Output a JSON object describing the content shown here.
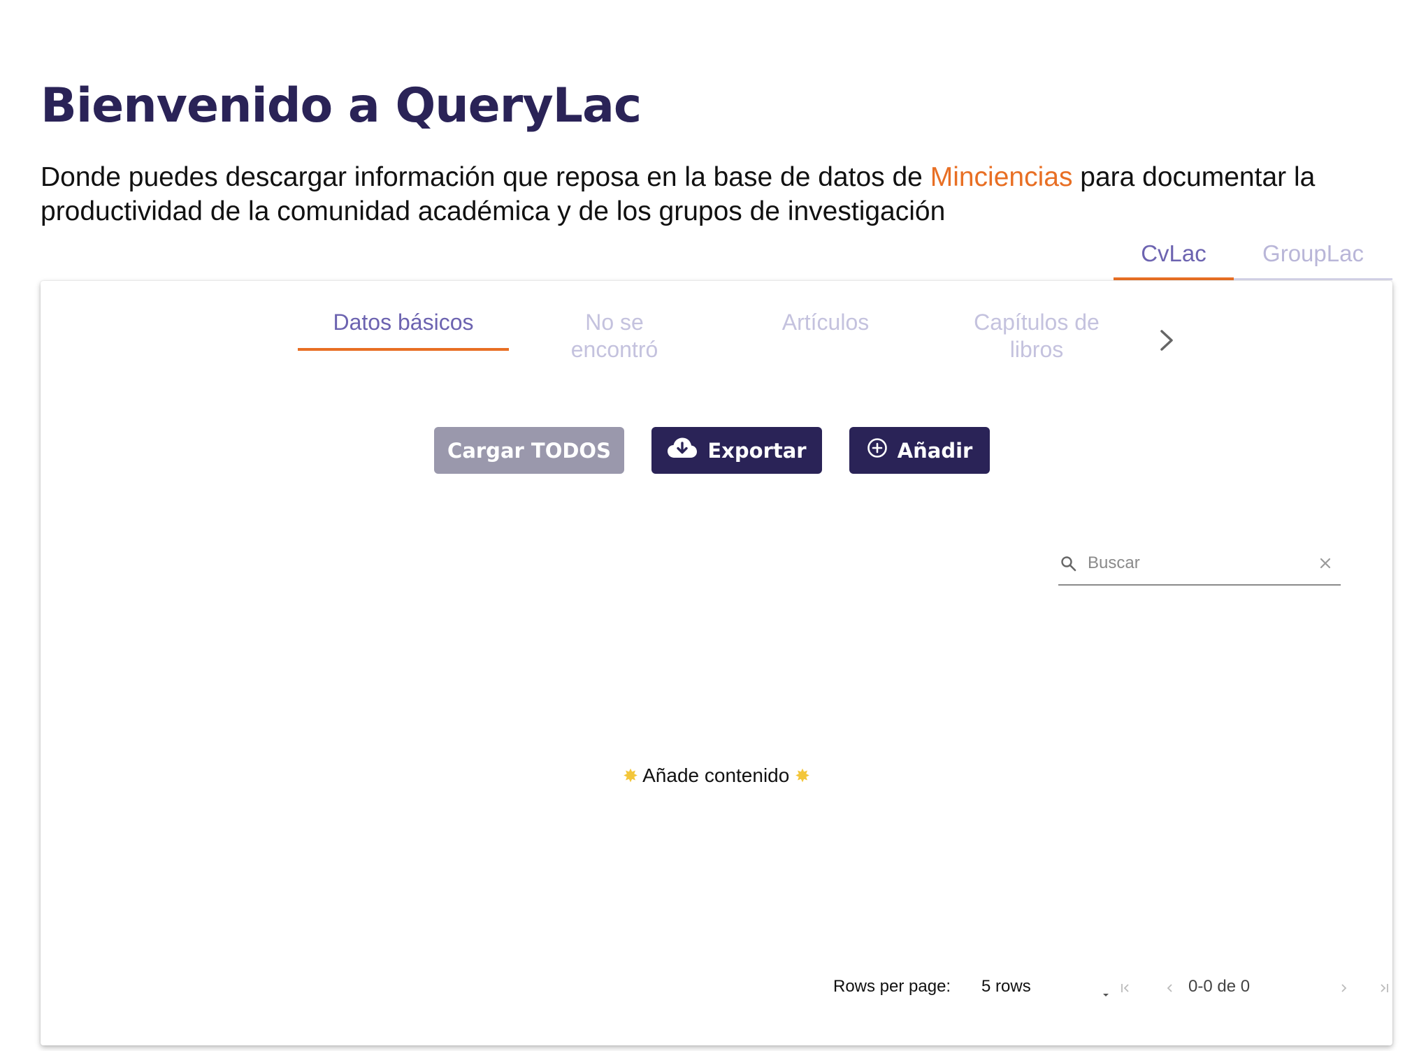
{
  "header": {
    "title": "Bienvenido a QueryLac",
    "intro_before": "Donde puedes descargar información que reposa en la base de datos de ",
    "intro_link": "Minciencias",
    "intro_after": " para documentar la productividad de la comunidad académica y de los grupos de investigación"
  },
  "top_tabs": [
    {
      "label": "CvLac",
      "active": true
    },
    {
      "label": "GroupLac",
      "active": false
    }
  ],
  "inner_tabs": [
    {
      "label": "Datos básicos",
      "active": true
    },
    {
      "label": "No se encontró",
      "active": false
    },
    {
      "label": "Artículos",
      "active": false
    },
    {
      "label": "Capítulos de libros",
      "active": false
    }
  ],
  "buttons": {
    "load_all": "Cargar TODOS",
    "export": "Exportar",
    "add": "Añadir"
  },
  "search": {
    "placeholder": "Buscar",
    "value": ""
  },
  "table": {
    "empty_message": "Añade contenido",
    "empty_icon": "glowing-star"
  },
  "pagination": {
    "rows_per_page_label": "Rows per page:",
    "rows_selected": "5 rows",
    "range": "0-0 de 0"
  },
  "colors": {
    "primary": "#2a2357",
    "accent": "#e86f24",
    "tab_active": "#6c63b0",
    "tab_inactive": "#c4c2de",
    "disabled_button": "#9a98ac"
  }
}
